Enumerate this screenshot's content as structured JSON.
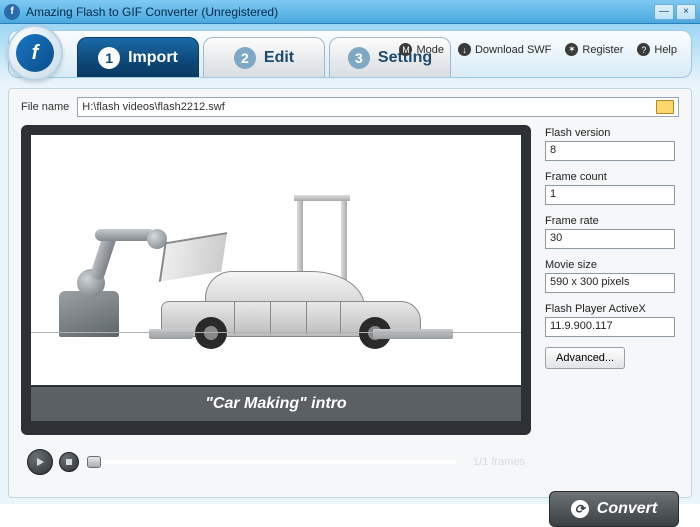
{
  "window": {
    "title": "Amazing Flash to GIF Converter (Unregistered)"
  },
  "tabs": [
    {
      "num": "1",
      "label": "Import"
    },
    {
      "num": "2",
      "label": "Edit"
    },
    {
      "num": "3",
      "label": "Setting"
    }
  ],
  "toplinks": {
    "mode": "Mode",
    "download": "Download SWF",
    "register": "Register",
    "help": "Help"
  },
  "file": {
    "label": "File name",
    "value": "H:\\flash videos\\flash2212.swf"
  },
  "preview": {
    "caption": "\"Car Making\" intro",
    "frames": "1/1 frames"
  },
  "info": {
    "flash_version": {
      "label": "Flash version",
      "value": "8"
    },
    "frame_count": {
      "label": "Frame count",
      "value": "1"
    },
    "frame_rate": {
      "label": "Frame rate",
      "value": "30"
    },
    "movie_size": {
      "label": "Movie size",
      "value": "590 x 300 pixels"
    },
    "activex": {
      "label": "Flash Player ActiveX",
      "value": "11.9.900.117"
    }
  },
  "buttons": {
    "advanced": "Advanced...",
    "convert": "Convert"
  }
}
